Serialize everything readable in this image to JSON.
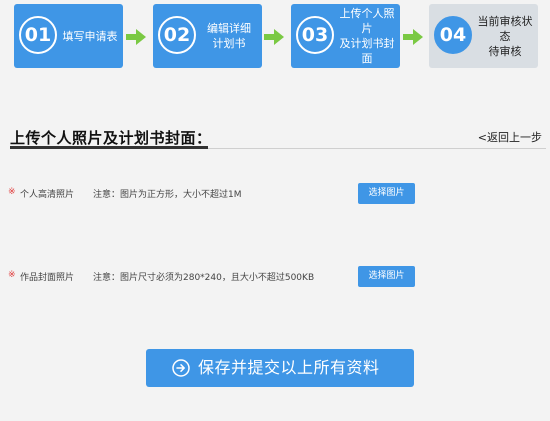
{
  "steps": [
    {
      "number": "01",
      "label": "填写申请表"
    },
    {
      "number": "02",
      "label": "编辑详细\n计划书"
    },
    {
      "number": "03",
      "label": "上传个人照片\n及计划书封面"
    },
    {
      "number": "04",
      "label": "当前审核状态\n待审核"
    }
  ],
  "section": {
    "title": "上传个人照片及计划书封面：",
    "back_link": "<返回上一步"
  },
  "fields": [
    {
      "required_mark": "※",
      "label": "个人高清照片",
      "note": "注意：图片为正方形，大小不超过1M",
      "button": "选择图片"
    },
    {
      "required_mark": "※",
      "label": "作品封面照片",
      "note": "注意：图片尺寸必须为280*240，且大小不超过500KB",
      "button": "选择图片"
    }
  ],
  "save": {
    "label": "保存并提交以上所有资料"
  },
  "colors": {
    "accent": "#3f96e6",
    "current_step_bg": "#d9dee3",
    "arrow": "#7ac943",
    "required": "#e03c3c"
  }
}
